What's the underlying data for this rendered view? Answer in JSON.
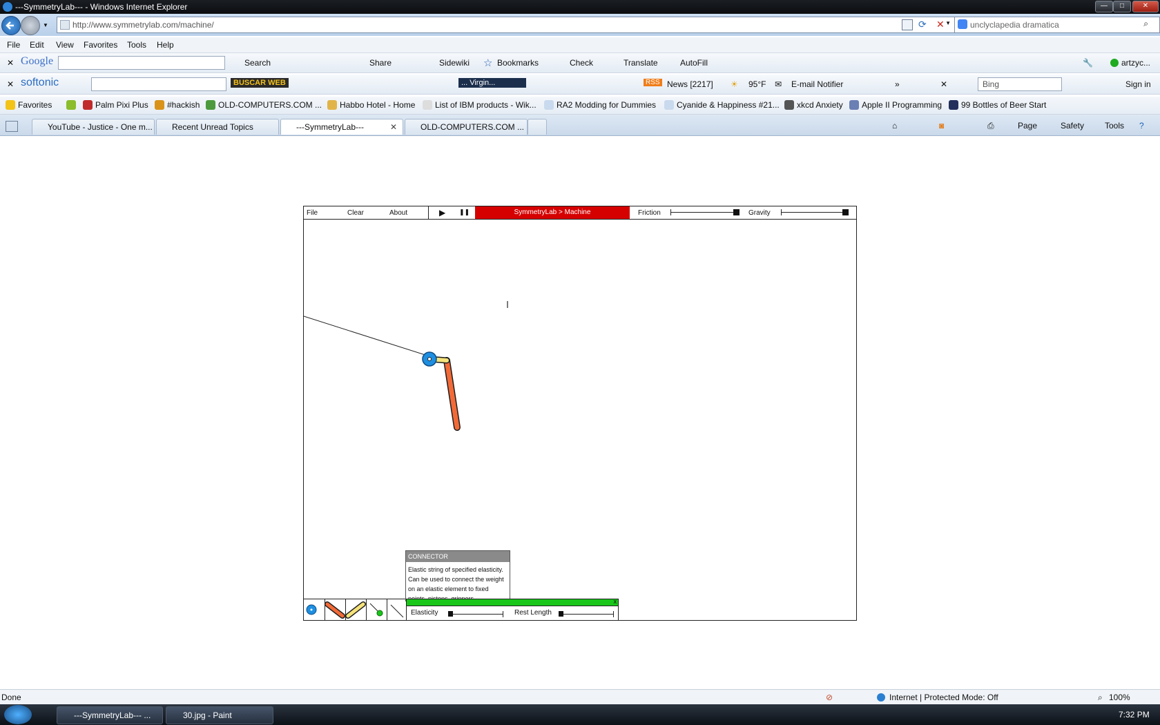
{
  "window": {
    "title": "---SymmetryLab--- - Windows Internet Explorer",
    "minimize_label": "—",
    "maximize_label": "□",
    "close_label": "✕"
  },
  "address_bar": {
    "url": "http://www.symmetrylab.com/machine/"
  },
  "search_box": {
    "value": "unclyclapedia dramatica"
  },
  "menu": [
    "File",
    "Edit",
    "View",
    "Favorites",
    "Tools",
    "Help"
  ],
  "google_toolbar": {
    "brand": "Google",
    "items": [
      "Search",
      "Share",
      "Sidewiki",
      "Bookmarks",
      "Check",
      "Translate",
      "AutoFill"
    ],
    "account": "artzyc..."
  },
  "softonic_toolbar": {
    "brand": "softonic",
    "buscar_label": "BUSCAR WEB",
    "radio_label": "... Virgin...",
    "rss_label": "RSS",
    "news_label": "News [2217]",
    "weather_label": "95°F",
    "email_label": "E-mail Notifier",
    "overflow_label": "»",
    "bing_value": "Bing",
    "signin_label": "Sign in"
  },
  "favorites": [
    "Favorites",
    "Palm Pixi Plus",
    "#hackish",
    "OLD-COMPUTERS.COM ...",
    "Habbo Hotel - Home",
    "List of IBM products - Wik...",
    "RA2 Modding for Dummies",
    "Cyanide & Happiness #21...",
    "xkcd Anxiety",
    "Apple II Programming",
    "99 Bottles of Beer",
    "Start"
  ],
  "tabs": [
    {
      "label": "YouTube - Justice - One m..."
    },
    {
      "label": "Recent Unread Topics"
    },
    {
      "label": "---SymmetryLab---",
      "close": "✕"
    },
    {
      "label": "OLD-COMPUTERS.COM ..."
    }
  ],
  "command_bar": [
    "Page",
    "Safety",
    "Tools"
  ],
  "app": {
    "menu": [
      "File",
      "Clear",
      "About"
    ],
    "play_label": "▶",
    "pause_label": "❚❚",
    "title": "SymmetryLab > Machine",
    "friction_label": "Friction",
    "gravity_label": "Gravity",
    "friction_level": 0.98,
    "gravity_level": 1.0,
    "tooltip": {
      "title": "CONNECTOR",
      "body": "Elastic string of specified elasticity. Can be used to connect the weight on an elastic element to fixed points, pistons, grippers"
    },
    "props": {
      "close_label": "x",
      "elasticity_label": "Elasticity",
      "rest_length_label": "Rest Length",
      "elasticity_level": 0.0,
      "rest_length_level": 0.0
    },
    "colors": {
      "title_bg": "#d50000",
      "wheel": "#1e8fe0",
      "rod": "#f26a37",
      "yellow": "#f5e27a",
      "props_bar": "#19c619"
    }
  },
  "status": {
    "text": "Done",
    "zone": "Internet | Protected Mode: Off",
    "zoom": "100%"
  },
  "taskbar": {
    "tasks": [
      "---SymmetryLab--- ...",
      "30.jpg - Paint"
    ],
    "clock": "7:32 PM"
  }
}
